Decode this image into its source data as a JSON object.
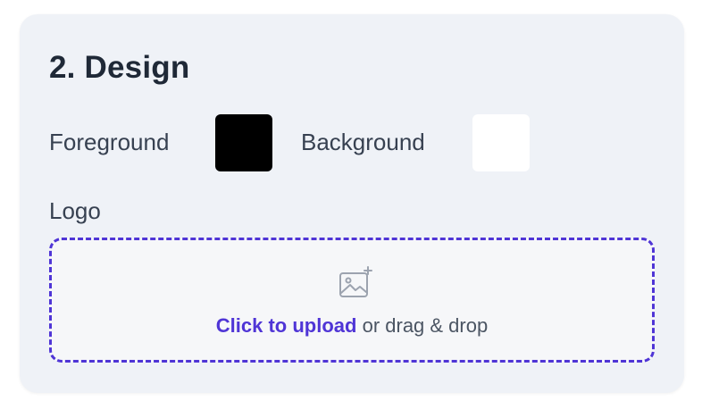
{
  "section": {
    "title": "2. Design"
  },
  "colors": {
    "foreground_label": "Foreground",
    "foreground_value": "#000000",
    "background_label": "Background",
    "background_value": "#ffffff"
  },
  "logo": {
    "label": "Logo",
    "upload_link": "Click to upload",
    "upload_hint": " or drag & drop",
    "icon": "image-add-icon",
    "accent": "#4f35d6"
  }
}
